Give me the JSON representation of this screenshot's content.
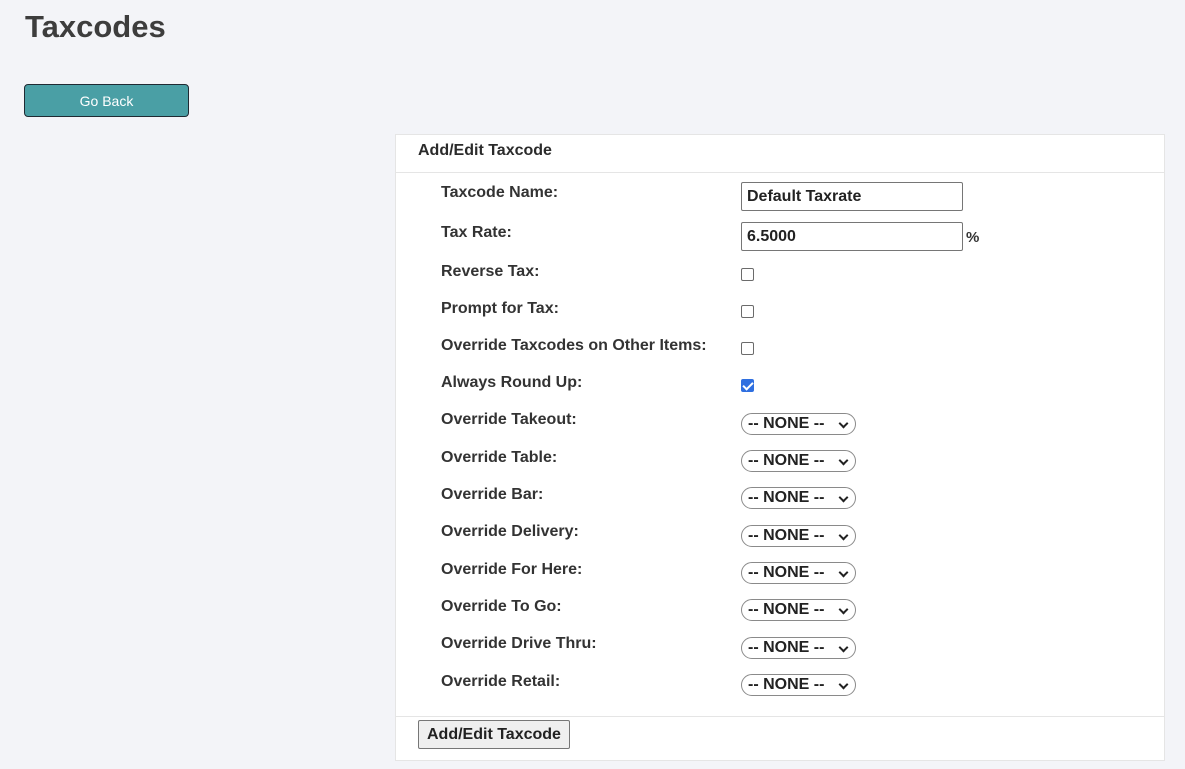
{
  "page": {
    "title": "Taxcodes"
  },
  "go_back": {
    "label": "Go Back"
  },
  "panel": {
    "title": "Add/Edit Taxcode",
    "submit_label": "Add/Edit Taxcode"
  },
  "fields": {
    "taxcode_name": {
      "label": "Taxcode Name:",
      "value": "Default Taxrate"
    },
    "tax_rate": {
      "label": "Tax Rate:",
      "value": "6.5000",
      "suffix": "%"
    },
    "reverse_tax": {
      "label": "Reverse Tax:",
      "checked": false
    },
    "prompt_for_tax": {
      "label": "Prompt for Tax:",
      "checked": false
    },
    "override_taxcodes": {
      "label": "Override Taxcodes on Other Items:",
      "checked": false
    },
    "always_round_up": {
      "label": "Always Round Up:",
      "checked": true
    }
  },
  "overrides": [
    {
      "label": "Override Takeout:",
      "value": "-- NONE --"
    },
    {
      "label": "Override Table:",
      "value": "-- NONE --"
    },
    {
      "label": "Override Bar:",
      "value": "-- NONE --"
    },
    {
      "label": "Override Delivery:",
      "value": "-- NONE --"
    },
    {
      "label": "Override For Here:",
      "value": "-- NONE --"
    },
    {
      "label": "Override To Go:",
      "value": "-- NONE --"
    },
    {
      "label": "Override Drive Thru:",
      "value": "-- NONE --"
    },
    {
      "label": "Override Retail:",
      "value": "-- NONE --"
    }
  ],
  "colors": {
    "go_back_bg": "#4a9fa5",
    "checkbox_checked": "#2f6fe0",
    "page_bg": "#f3f4f8"
  }
}
